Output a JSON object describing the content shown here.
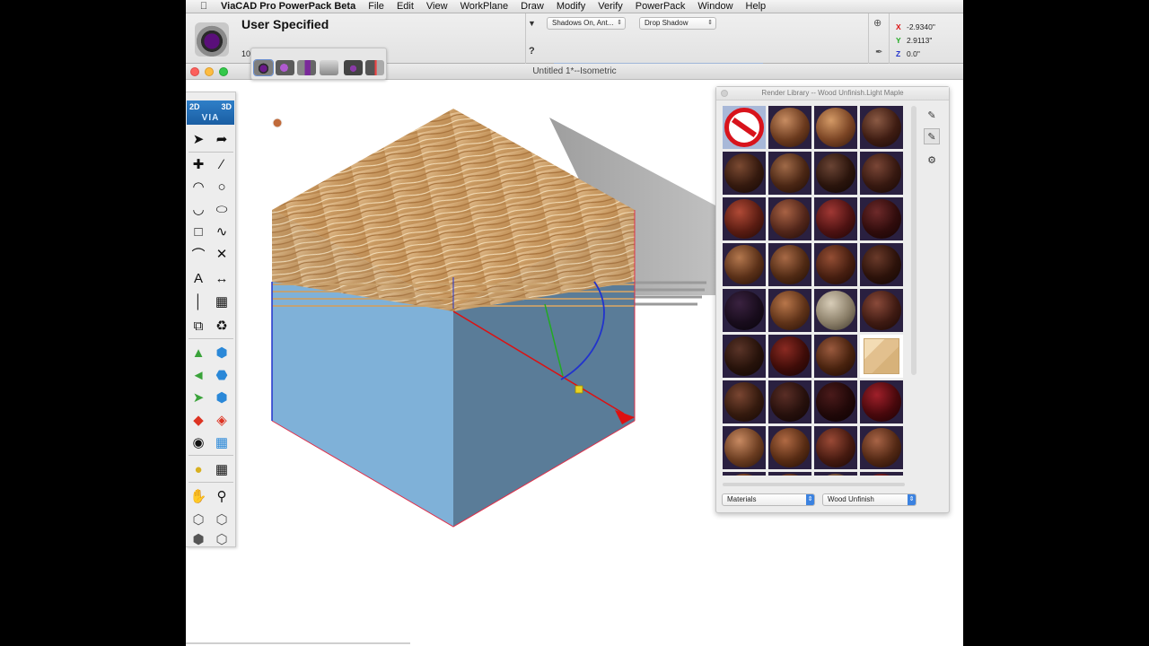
{
  "menubar": {
    "app_name": "ViaCAD Pro PowerPack Beta",
    "items": [
      "File",
      "Edit",
      "View",
      "WorkPlane",
      "Draw",
      "Modify",
      "Verify",
      "PowerPack",
      "Window",
      "Help"
    ]
  },
  "controlbar": {
    "mode_title": "User Specified",
    "mode_value": "10",
    "shadows_option": "Shadows On, Ant...",
    "drop_shadow_option": "Drop Shadow",
    "help_glyph": "?",
    "coords": {
      "x_label": "X",
      "x": "-2.9340\"",
      "y_label": "Y",
      "y": "2.9113\"",
      "z_label": "Z",
      "z": "0.0\""
    }
  },
  "document": {
    "title": "Untitled 1*--Isometric"
  },
  "toolpalette": {
    "logo_2d": "2D",
    "logo_3d": "3D",
    "logo_via": "VIA"
  },
  "render_library": {
    "title": "Render Library -- Wood Unfinish.Light Maple",
    "category": "Materials",
    "subcategory": "Wood Unfinish"
  },
  "colors": {
    "accent": "#3b82e0",
    "x_axis": "#dd1111",
    "y_axis": "#22aa22",
    "z_axis": "#2233cc",
    "box_side": "#7fb1d8",
    "box_front": "#5a7c98"
  }
}
